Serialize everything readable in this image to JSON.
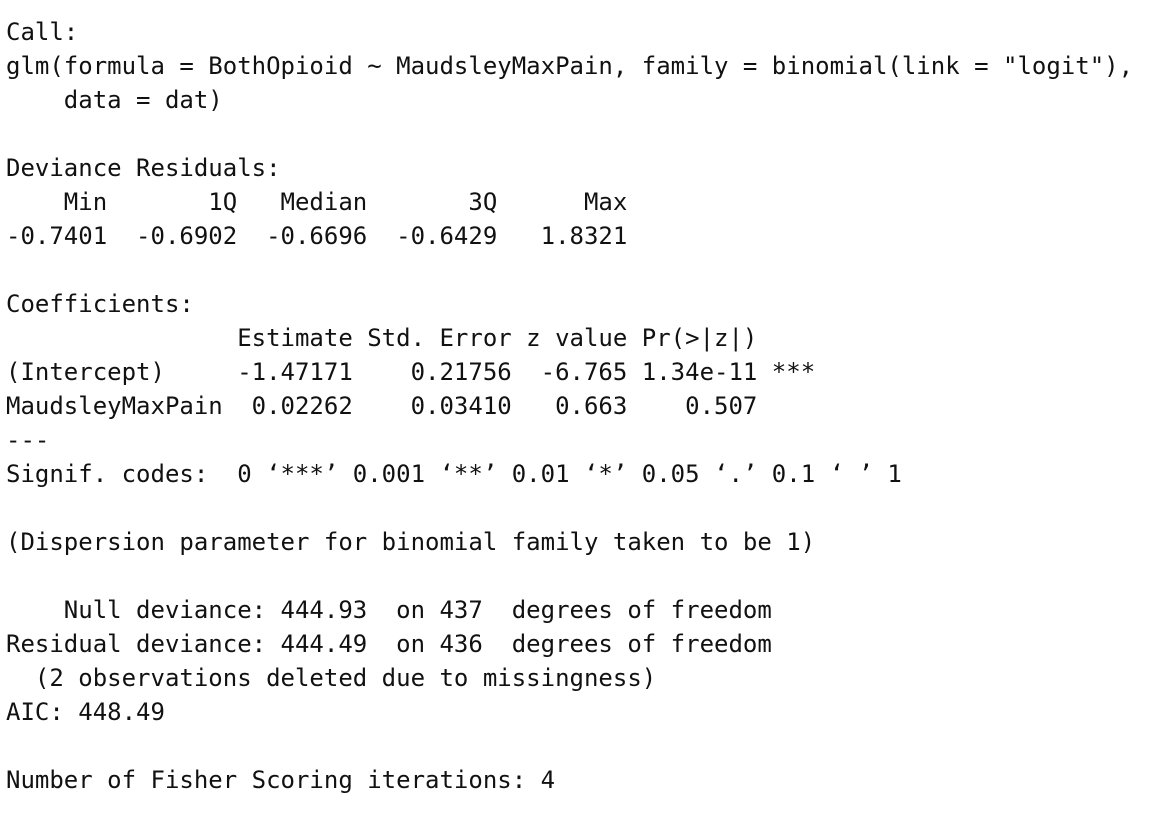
{
  "output": {
    "lines": [
      "Call:",
      "glm(formula = BothOpioid ~ MaudsleyMaxPain, family = binomial(link = \"logit\"),",
      "    data = dat)",
      "",
      "Deviance Residuals:",
      "    Min       1Q   Median       3Q      Max",
      "-0.7401  -0.6902  -0.6696  -0.6429   1.8321",
      "",
      "Coefficients:",
      "                Estimate Std. Error z value Pr(>|z|)",
      "(Intercept)     -1.47171    0.21756  -6.765 1.34e-11 ***",
      "MaudsleyMaxPain  0.02262    0.03410   0.663    0.507",
      "---",
      "Signif. codes:  0 ‘***’ 0.001 ‘**’ 0.01 ‘*’ 0.05 ‘.’ 0.1 ‘ ’ 1",
      "",
      "(Dispersion parameter for binomial family taken to be 1)",
      "",
      "    Null deviance: 444.93  on 437  degrees of freedom",
      "Residual deviance: 444.49  on 436  degrees of freedom",
      "  (2 observations deleted due to missingness)",
      "AIC: 448.49",
      "",
      "Number of Fisher Scoring iterations: 4"
    ]
  }
}
